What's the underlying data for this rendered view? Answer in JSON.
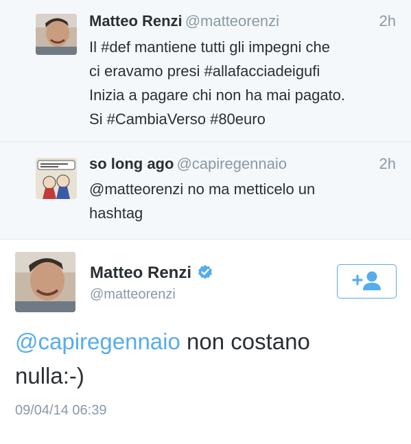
{
  "tweets": [
    {
      "name": "Matteo Renzi",
      "handle": "@matteorenzi",
      "time": "2h",
      "lines": [
        "Il #def mantiene tutti gli impegni che",
        "ci eravamo presi #allafacciadeigufi",
        "Inizia a pagare chi non ha mai pagato.",
        "Si #CambiaVerso #80euro"
      ]
    },
    {
      "name": "so long ago",
      "handle": "@capiregennaio",
      "time": "2h",
      "lines": [
        "@matteorenzi no ma metticelo un",
        "hashtag"
      ]
    }
  ],
  "main_tweet": {
    "name": "Matteo Renzi",
    "handle": "@matteorenzi",
    "verified": true,
    "mention": "@capiregennaio",
    "text_after_mention": " non costano",
    "text_line2": "nulla:-)",
    "date": "09/04/14 06:39",
    "follow_icon": "add-user-icon"
  },
  "colors": {
    "accent": "#55acee",
    "muted": "#8899a6",
    "text": "#292f33",
    "compact_bg": "#f5f8fa",
    "divider": "#e1e8ed"
  }
}
